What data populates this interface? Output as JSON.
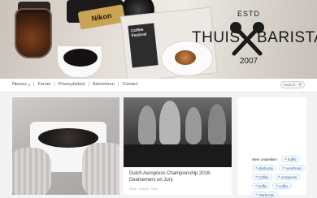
{
  "hero": {
    "camera_brand": "Nikon",
    "book_cover_text": "Coffee Festival"
  },
  "logo": {
    "estd": "ESTD",
    "left_word": "THUIS",
    "right_word": "BARISTA",
    "year": "2007"
  },
  "nav": {
    "items": [
      {
        "label": "Nieuws",
        "has_dropdown": true
      },
      {
        "label": "Forum"
      },
      {
        "label": "Privacybeleid"
      },
      {
        "label": "Adverteren"
      },
      {
        "label": "Contact"
      }
    ],
    "search_placeholder": "Search..."
  },
  "posts": [
    {
      "title": "Dutch Aeropress Championship 2016: Deelnemers en Jury",
      "meta": "Amsk · 15 April · 2016"
    }
  ],
  "sidebar": {
    "tags": [
      {
        "label": "Meer ontdekken",
        "plain": true
      },
      {
        "label": "Koffie"
      },
      {
        "label": "starbucks"
      },
      {
        "label": "AeroPress"
      },
      {
        "label": "Coffee"
      },
      {
        "label": "Aeropress"
      },
      {
        "label": "koffie"
      },
      {
        "label": "coffee"
      },
      {
        "label": "Starbucks"
      }
    ]
  },
  "colors": {
    "tag_text": "#2f5f99",
    "tag_border": "#d8e2ee"
  }
}
